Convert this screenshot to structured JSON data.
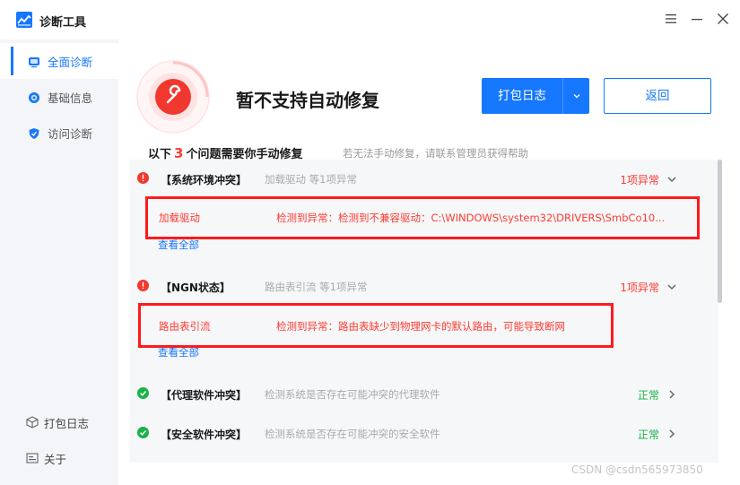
{
  "window": {
    "title": "诊断工具",
    "icons": {
      "logo": "chart-logo-icon",
      "menu": "menu-icon",
      "minimize": "minimize-icon",
      "close": "close-icon"
    }
  },
  "sidebar": {
    "items": [
      {
        "label": "全面诊断",
        "icon": "monitor-icon",
        "active": true
      },
      {
        "label": "基础信息",
        "icon": "info-icon",
        "active": false
      },
      {
        "label": "访问诊断",
        "icon": "shield-icon",
        "active": false
      }
    ],
    "bottom": [
      {
        "label": "打包日志",
        "icon": "package-icon"
      },
      {
        "label": "关于",
        "icon": "about-icon"
      }
    ]
  },
  "header": {
    "status_title": "暂不支持自动修复",
    "export_button": "打包日志",
    "back_button": "返回",
    "summary_prefix": "以下",
    "summary_count": "3",
    "summary_suffix": "个问题需要你手动修复",
    "summary_hint": "若无法手动修复，请联系管理员获得帮助"
  },
  "rows": [
    {
      "title": "【系统环境冲突】",
      "desc": "加载驱动 等1项异常",
      "status": "1项异常",
      "state": "error",
      "detail_key": "加载驱动",
      "detail_val": "检测到异常：检测到不兼容驱动：C:\\WINDOWS\\system32\\DRIVERS\\SmbCo10...",
      "view_all": "查看全部"
    },
    {
      "title": "【NGN状态】",
      "desc": "路由表引流 等1项异常",
      "status": "1项异常",
      "state": "error",
      "detail_key": "路由表引流",
      "detail_val": "检测到异常：路由表缺少到物理网卡的默认路由，可能导致断网",
      "view_all": "查看全部"
    },
    {
      "title": "【代理软件冲突】",
      "desc": "检测系统是否存在可能冲突的代理软件",
      "status": "正常",
      "state": "ok"
    },
    {
      "title": "【安全软件冲突】",
      "desc": "检测系统是否存在可能冲突的安全软件",
      "status": "正常",
      "state": "ok"
    }
  ],
  "colors": {
    "accent": "#1677ff",
    "error": "#ff3b30",
    "ok": "#19b347"
  },
  "watermark": "CSDN @csdn565973850"
}
